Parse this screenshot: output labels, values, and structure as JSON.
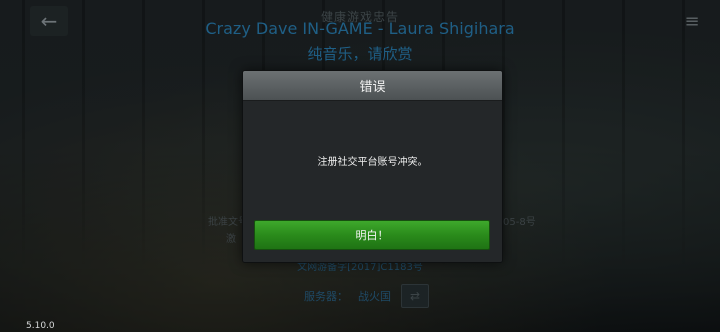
{
  "top": {
    "notice": "健康游戏忠告",
    "song": "Crazy Dave IN-GAME - Laura Shigihara",
    "subtitle": "纯音乐，请欣赏",
    "back_icon": "←",
    "settings_icon": "≡"
  },
  "dialog": {
    "title": "错误",
    "message": "注册社交平台账号冲突。",
    "ok_label": "明白！"
  },
  "footer": {
    "left_line1": "批准文号",
    "left_line2": "激",
    "right_line1": "05-8号",
    "right_line2": "",
    "license": "文网游备字[2017]C1183号",
    "server_label": "服务器：",
    "server_name": "战火国"
  },
  "version": "5.10.0",
  "colors": {
    "accent_green": "#2a8b1b",
    "link_blue": "#1f5f86",
    "header_gray": "#5c6163"
  }
}
